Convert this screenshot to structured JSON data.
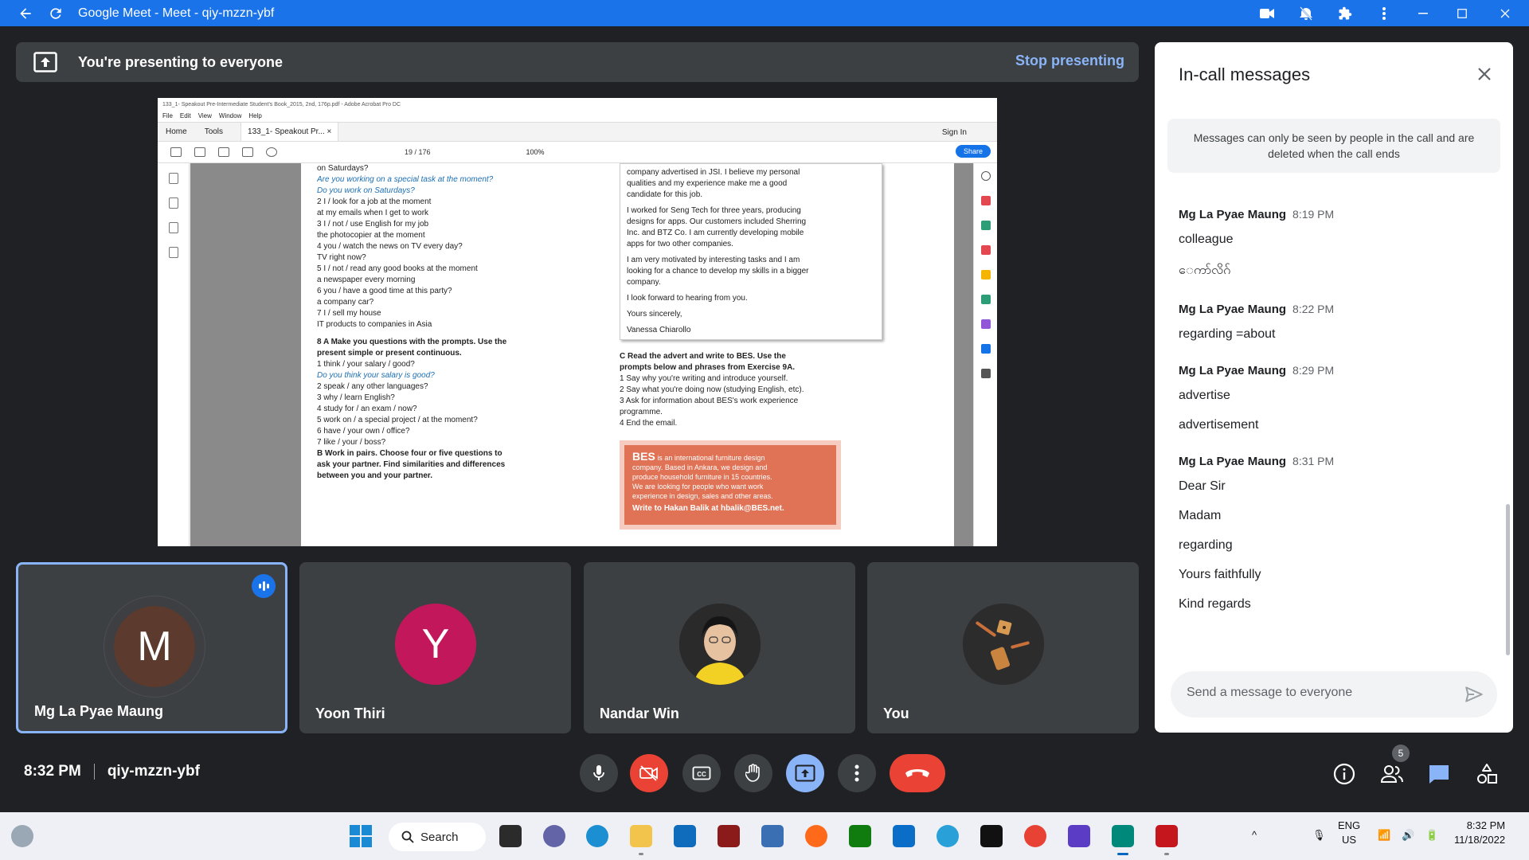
{
  "window": {
    "title": "Google Meet - Meet - qiy-mzzn-ybf"
  },
  "banner": {
    "message": "You're presenting to everyone",
    "stop_label": "Stop presenting"
  },
  "shared": {
    "title": "133_1- Speakout Pre-Intermediate Student's Book_2015, 2nd, 176p.pdf - Adobe Acrobat Pro DC",
    "menu": [
      "File",
      "Edit",
      "View",
      "Window",
      "Help"
    ],
    "tabs": [
      "Home",
      "Tools",
      "133_1- Speakout Pr...  ×"
    ],
    "sign_in": "Sign In",
    "page_info": "19  /  176",
    "zoom": "100%",
    "share": "Share",
    "col1": [
      {
        "t": "on Saturdays?",
        "c": "plain"
      },
      {
        "t": "Are you working on a special task at the moment?",
        "c": "it"
      },
      {
        "t": "Do you work on Saturdays?",
        "c": "it"
      },
      {
        "t": "2  I / look          for a job at the moment",
        "c": "plain"
      },
      {
        "t": "                         at my emails when I get to work",
        "c": "plain"
      },
      {
        "t": "3  I / not / use    English for my job",
        "c": "plain"
      },
      {
        "t": "                         the photocopier at the moment",
        "c": "plain"
      },
      {
        "t": "4  you / watch     the news on TV every day?",
        "c": "plain"
      },
      {
        "t": "                         TV right now?",
        "c": "plain"
      },
      {
        "t": "5  I / not / read   any good books at the moment",
        "c": "plain"
      },
      {
        "t": "                         a newspaper every morning",
        "c": "plain"
      },
      {
        "t": "6  you / have       a good time at this party?",
        "c": "plain"
      },
      {
        "t": "                         a company car?",
        "c": "plain"
      },
      {
        "t": "7  I / sell            my house",
        "c": "plain"
      },
      {
        "t": "                         IT products to companies in Asia",
        "c": "plain"
      },
      {
        "t": "",
        "c": "plain"
      },
      {
        "t": "8 A  Make you questions with the prompts. Use the",
        "c": "bold"
      },
      {
        "t": "present simple or present continuous.",
        "c": "bold"
      },
      {
        "t": "1  think / your salary / good?",
        "c": "plain"
      },
      {
        "t": "Do you think your salary is good?",
        "c": "it"
      },
      {
        "t": "2  speak / any other languages?",
        "c": "plain"
      },
      {
        "t": "3  why / learn English?",
        "c": "plain"
      },
      {
        "t": "4  study for / an exam / now?",
        "c": "plain"
      },
      {
        "t": "5  work on / a special project / at the moment?",
        "c": "plain"
      },
      {
        "t": "6  have / your own / office?",
        "c": "plain"
      },
      {
        "t": "7  like / your / boss?",
        "c": "plain"
      },
      {
        "t": "B  Work in pairs. Choose four or five questions to",
        "c": "bold"
      },
      {
        "t": "ask your partner. Find similarities and differences",
        "c": "bold"
      },
      {
        "t": "between you and your partner.",
        "c": "bold"
      }
    ],
    "letter": [
      "company advertised in JSI. I believe my personal",
      "qualities and my experience make me a good",
      "candidate for this job.",
      "I worked for Seng Tech for three years, producing",
      "designs for apps. Our customers included Sherring",
      "Inc. and BTZ Co. I am currently developing mobile",
      "apps for two other companies.",
      "I am very motivated by interesting tasks and I am",
      "looking for a chance to develop my skills in a bigger",
      "company.",
      "I look forward to hearing from you.",
      "Yours sincerely,",
      "Vanessa Chiarollo"
    ],
    "col2": [
      {
        "t": "C  Read the advert and write to BES. Use the",
        "c": "bold"
      },
      {
        "t": "prompts below and phrases from Exercise 9A.",
        "c": "bold"
      },
      {
        "t": "1  Say why you're writing and introduce yourself.",
        "c": "plain"
      },
      {
        "t": "2  Say what you're doing now (studying English, etc).",
        "c": "plain"
      },
      {
        "t": "3  Ask for information about BES's work experience",
        "c": "plain"
      },
      {
        "t": "    programme.",
        "c": "plain"
      },
      {
        "t": "4  End the email.",
        "c": "plain"
      }
    ],
    "bes": {
      "head": "BES",
      "lines": [
        "is an international furniture design",
        "company. Based in Ankara, we design and",
        "produce household furniture in 15 countries.",
        "We are looking for people who want work",
        "experience in design, sales and other areas."
      ],
      "write": "Write to Hakan Balik at hbalik@BES.net."
    }
  },
  "participants": [
    {
      "name": "Mg La Pyae Maung",
      "initial": "M"
    },
    {
      "name": "Yoon Thiri",
      "initial": "Y"
    },
    {
      "name": "Nandar Win",
      "initial": ""
    },
    {
      "name": "You",
      "initial": ""
    }
  ],
  "chat": {
    "title": "In-call messages",
    "notice": "Messages can only be seen by people in the call and are deleted when the call ends",
    "groups": [
      {
        "sender": "Mg La Pyae Maung",
        "time": "8:19 PM",
        "messages": [
          "colleague",
          "ေကာ်လိဂ်"
        ]
      },
      {
        "sender": "Mg La Pyae Maung",
        "time": "8:22 PM",
        "messages": [
          "regarding =about"
        ]
      },
      {
        "sender": "Mg La Pyae Maung",
        "time": "8:29 PM",
        "messages": [
          "advertise",
          "advertisement"
        ]
      },
      {
        "sender": "Mg La Pyae Maung",
        "time": "8:31 PM",
        "messages": [
          "Dear Sir",
          "Madam",
          "regarding",
          "Yours faithfully",
          "Kind regards"
        ]
      }
    ],
    "input_placeholder": "Send a message to everyone"
  },
  "bottom": {
    "time": "8:32 PM",
    "meeting_code": "qiy-mzzn-ybf",
    "people_count": "5"
  },
  "taskbar": {
    "search": "Search",
    "lang1": "ENG",
    "lang2": "US",
    "clock_time": "8:32 PM",
    "clock_date": "11/18/2022"
  },
  "colors": {
    "accent": "#1a73e8",
    "danger": "#ea4335",
    "link": "#8ab4f8"
  }
}
